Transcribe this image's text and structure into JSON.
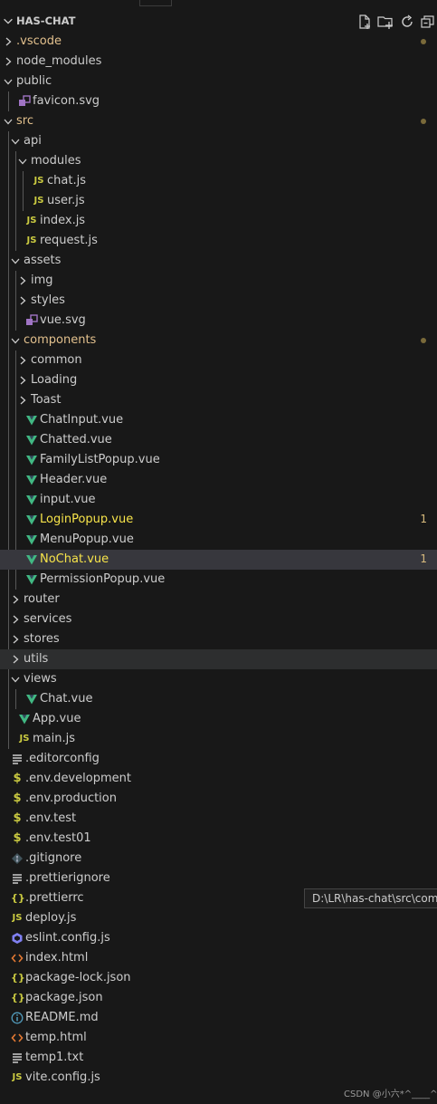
{
  "explorer": {
    "root_label": "HAS-CHAT",
    "action_icons": [
      "new-file-icon",
      "new-folder-icon",
      "refresh-icon",
      "collapse-all-icon"
    ]
  },
  "colors": {
    "background": "#181818",
    "text": "#cccccc",
    "modified": "#e2c08d",
    "error": "#f7e44a",
    "vue": "#41b883",
    "js": "#cbcb41",
    "dot": "#7a6a3a",
    "selected": "#37373d"
  },
  "tree": [
    {
      "label": ".vscode",
      "depth": 0,
      "kind": "folder",
      "open": false,
      "modified": true
    },
    {
      "label": "node_modules",
      "depth": 0,
      "kind": "folder",
      "open": false
    },
    {
      "label": "public",
      "depth": 0,
      "kind": "folder",
      "open": true
    },
    {
      "label": "favicon.svg",
      "depth": 1,
      "kind": "svg",
      "icon": "svg-file-icon"
    },
    {
      "label": "src",
      "depth": 0,
      "kind": "folder",
      "open": true,
      "modified": true
    },
    {
      "label": "api",
      "depth": 1,
      "kind": "folder",
      "open": true
    },
    {
      "label": "modules",
      "depth": 2,
      "kind": "folder",
      "open": true
    },
    {
      "label": "chat.js",
      "depth": 3,
      "kind": "js",
      "icon": "js-file-icon"
    },
    {
      "label": "user.js",
      "depth": 3,
      "kind": "js",
      "icon": "js-file-icon"
    },
    {
      "label": "index.js",
      "depth": 2,
      "kind": "js",
      "icon": "js-file-icon"
    },
    {
      "label": "request.js",
      "depth": 2,
      "kind": "js",
      "icon": "js-file-icon"
    },
    {
      "label": "assets",
      "depth": 1,
      "kind": "folder",
      "open": true
    },
    {
      "label": "img",
      "depth": 2,
      "kind": "folder",
      "open": false
    },
    {
      "label": "styles",
      "depth": 2,
      "kind": "folder",
      "open": false
    },
    {
      "label": "vue.svg",
      "depth": 2,
      "kind": "svg",
      "icon": "svg-file-icon"
    },
    {
      "label": "components",
      "depth": 1,
      "kind": "folder",
      "open": true,
      "modified": true
    },
    {
      "label": "common",
      "depth": 2,
      "kind": "folder",
      "open": false
    },
    {
      "label": "Loading",
      "depth": 2,
      "kind": "folder",
      "open": false
    },
    {
      "label": "Toast",
      "depth": 2,
      "kind": "folder",
      "open": false
    },
    {
      "label": "ChatInput.vue",
      "depth": 2,
      "kind": "vue",
      "icon": "vue-file-icon"
    },
    {
      "label": "Chatted.vue",
      "depth": 2,
      "kind": "vue",
      "icon": "vue-file-icon"
    },
    {
      "label": "FamilyListPopup.vue",
      "depth": 2,
      "kind": "vue",
      "icon": "vue-file-icon"
    },
    {
      "label": "Header.vue",
      "depth": 2,
      "kind": "vue",
      "icon": "vue-file-icon"
    },
    {
      "label": "input.vue",
      "depth": 2,
      "kind": "vue",
      "icon": "vue-file-icon"
    },
    {
      "label": "LoginPopup.vue",
      "depth": 2,
      "kind": "vue",
      "icon": "vue-file-icon",
      "error": true,
      "count": "1"
    },
    {
      "label": "MenuPopup.vue",
      "depth": 2,
      "kind": "vue",
      "icon": "vue-file-icon"
    },
    {
      "label": "NoChat.vue",
      "depth": 2,
      "kind": "vue",
      "icon": "vue-file-icon",
      "error": true,
      "count": "1",
      "selected": true
    },
    {
      "label": "PermissionPopup.vue",
      "depth": 2,
      "kind": "vue",
      "icon": "vue-file-icon"
    },
    {
      "label": "router",
      "depth": 1,
      "kind": "folder",
      "open": false
    },
    {
      "label": "services",
      "depth": 1,
      "kind": "folder",
      "open": false
    },
    {
      "label": "stores",
      "depth": 1,
      "kind": "folder",
      "open": false
    },
    {
      "label": "utils",
      "depth": 1,
      "kind": "folder",
      "open": false,
      "hover": true
    },
    {
      "label": "views",
      "depth": 1,
      "kind": "folder",
      "open": true
    },
    {
      "label": "Chat.vue",
      "depth": 2,
      "kind": "vue",
      "icon": "vue-file-icon"
    },
    {
      "label": "App.vue",
      "depth": 1,
      "kind": "vue",
      "icon": "vue-file-icon"
    },
    {
      "label": "main.js",
      "depth": 1,
      "kind": "js",
      "icon": "js-file-icon"
    },
    {
      "label": ".editorconfig",
      "depth": 0,
      "kind": "lines",
      "icon": "config-file-icon"
    },
    {
      "label": ".env.development",
      "depth": 0,
      "kind": "env",
      "icon": "env-file-icon"
    },
    {
      "label": ".env.production",
      "depth": 0,
      "kind": "env",
      "icon": "env-file-icon"
    },
    {
      "label": ".env.test",
      "depth": 0,
      "kind": "env",
      "icon": "env-file-icon"
    },
    {
      "label": ".env.test01",
      "depth": 0,
      "kind": "env",
      "icon": "env-file-icon"
    },
    {
      "label": ".gitignore",
      "depth": 0,
      "kind": "git",
      "icon": "git-file-icon"
    },
    {
      "label": ".prettierignore",
      "depth": 0,
      "kind": "lines",
      "icon": "config-file-icon"
    },
    {
      "label": ".prettierrc",
      "depth": 0,
      "kind": "json",
      "icon": "json-file-icon"
    },
    {
      "label": "deploy.js",
      "depth": 0,
      "kind": "js",
      "icon": "js-file-icon"
    },
    {
      "label": "eslint.config.js",
      "depth": 0,
      "kind": "eslint",
      "icon": "eslint-file-icon"
    },
    {
      "label": "index.html",
      "depth": 0,
      "kind": "html",
      "icon": "html-file-icon"
    },
    {
      "label": "package-lock.json",
      "depth": 0,
      "kind": "json",
      "icon": "json-file-icon"
    },
    {
      "label": "package.json",
      "depth": 0,
      "kind": "json",
      "icon": "json-file-icon"
    },
    {
      "label": "README.md",
      "depth": 0,
      "kind": "info",
      "icon": "info-file-icon"
    },
    {
      "label": "temp.html",
      "depth": 0,
      "kind": "html",
      "icon": "html-file-icon"
    },
    {
      "label": "temp1.txt",
      "depth": 0,
      "kind": "lines",
      "icon": "text-file-icon"
    },
    {
      "label": "vite.config.js",
      "depth": 0,
      "kind": "js",
      "icon": "js-file-icon"
    }
  ],
  "tooltip": {
    "text": "D:\\LR\\has-chat\\src\\compo"
  },
  "watermark": "CSDN @小六*^____^*"
}
